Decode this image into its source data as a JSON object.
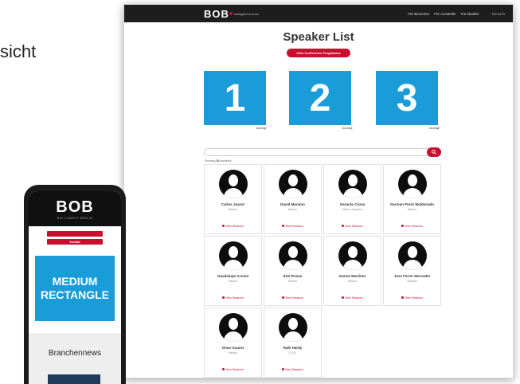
{
  "left_text": "sicht",
  "desktop": {
    "logo_text": "BOB",
    "tagline": "instagramm-buch",
    "nav": [
      "Für Besucher",
      "Für Aussteller",
      "Für Medien"
    ],
    "language": "Deutsch",
    "page_title": "Speaker List",
    "program_button": "View Conference Programme",
    "sponsors": [
      {
        "number": "1",
        "label": "Anzeige"
      },
      {
        "number": "2",
        "label": "Anzeige"
      },
      {
        "number": "3",
        "label": "Anzeige"
      }
    ],
    "showing_prefix": "Showing",
    "showing_count": "10",
    "showing_suffix": "speakers",
    "session_link": "View Sessions",
    "speakers": [
      {
        "name": "Carlos Juarez",
        "country": "Mexico"
      },
      {
        "name": "David Mariano",
        "country": "Mexico"
      },
      {
        "name": "Gerardo Corea",
        "country": "Mexico-Spanien"
      },
      {
        "name": "German Perez Maldonado",
        "country": "Mexico"
      },
      {
        "name": "Guadalupe Acosta",
        "country": "Mexico"
      },
      {
        "name": "Itzel Rosas",
        "country": "Mexico"
      },
      {
        "name": "Ivonne Martinez",
        "country": "Mexico"
      },
      {
        "name": "Jose Ferrer Mercader",
        "country": "Spanien"
      },
      {
        "name": "Omar Suarez",
        "country": "Mexico"
      },
      {
        "name": "Rafe Hardy",
        "country": "IT-US"
      }
    ]
  },
  "mobile": {
    "logo_text": "BOB",
    "logo_sub": "BIG COMEDY BERLIN",
    "contact_button": "Kontakt",
    "ad_line1": "MEDIUM",
    "ad_line2": "RECTANGLE",
    "news_heading": "Branchennews"
  },
  "colors": {
    "accent": "#c8102e",
    "sponsor_blue": "#1a9cd8",
    "topbar": "#1d1d1d"
  }
}
